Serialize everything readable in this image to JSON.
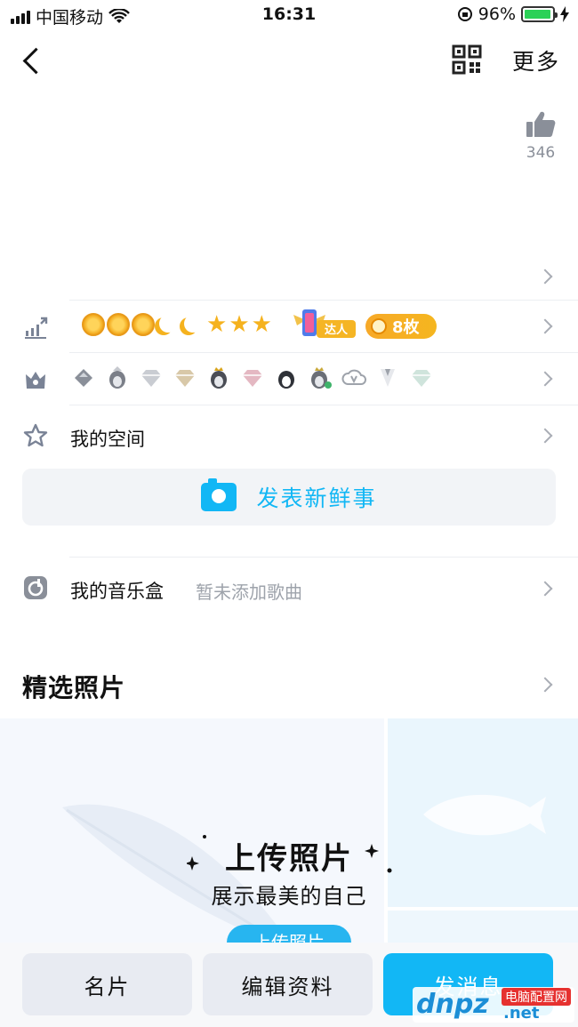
{
  "status_bar": {
    "carrier": "中国移动",
    "time": "16:31",
    "battery": "96%",
    "battery_level": 0.96
  },
  "nav": {
    "more_label": "更多"
  },
  "like": {
    "count": "346"
  },
  "level_row": {
    "daren_label": "达人",
    "medal_count": "8枚"
  },
  "space_row": {
    "label": "我的空间"
  },
  "post": {
    "label": "发表新鲜事"
  },
  "music": {
    "label": "我的音乐盒",
    "sub": "暂未添加歌曲"
  },
  "photos": {
    "section_title": "精选照片",
    "upload_title": "上传照片",
    "upload_sub": "展示最美的自己",
    "upload_button": "上传照片"
  },
  "bottom": {
    "card_label": "名片",
    "edit_label": "编辑资料",
    "message_label": "发消息"
  },
  "watermark": {
    "logo": "dnpz",
    "tag": "电脑配置网",
    "suffix": ".net"
  },
  "colors": {
    "accent": "#12b7f5",
    "medal": "#f5b21e"
  }
}
